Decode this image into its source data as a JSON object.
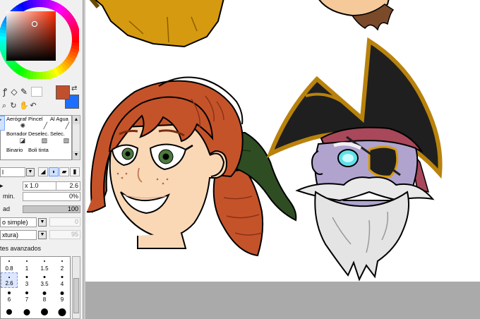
{
  "tools": [
    {
      "name": "aerografo",
      "label": "Aerógraf",
      "icon": "airbrush-icon"
    },
    {
      "name": "pincel",
      "label": "Pincel",
      "icon": "brush-icon"
    },
    {
      "name": "al-agua",
      "label": "Al Agua",
      "icon": "water-icon"
    },
    {
      "name": "borrador",
      "label": "Borrador",
      "icon": "eraser-icon"
    },
    {
      "name": "deselec",
      "label": "Deselec.",
      "icon": "deselect-icon"
    },
    {
      "name": "selec",
      "label": "Selec.",
      "icon": "select-icon"
    },
    {
      "name": "binario",
      "label": "Binario",
      "icon": ""
    },
    {
      "name": "boli-tinta",
      "label": "Boli tinta",
      "icon": ""
    }
  ],
  "settings": {
    "size_multiplier": "x 1.0",
    "size_value": "2.6",
    "min_label": "min.",
    "min_value": "0%",
    "density_label": "ad",
    "density_value": "100",
    "blend_label": "o simple)",
    "blend_value": "0",
    "texture_label": "xtura)",
    "texture_value": "95",
    "advanced_label": "tes avanzados"
  },
  "sizes": [
    {
      "label": "0.8",
      "dot": 2
    },
    {
      "label": "1",
      "dot": 2
    },
    {
      "label": "1.5",
      "dot": 2
    },
    {
      "label": "2",
      "dot": 2
    },
    {
      "label": "2.6",
      "dot": 2,
      "active": true
    },
    {
      "label": "3",
      "dot": 3
    },
    {
      "label": "3.5",
      "dot": 3
    },
    {
      "label": "4",
      "dot": 3
    },
    {
      "label": "6",
      "dot": 4
    },
    {
      "label": "7",
      "dot": 4
    },
    {
      "label": "8",
      "dot": 5
    },
    {
      "label": "9",
      "dot": 5
    },
    {
      "label": "",
      "dot": 8
    },
    {
      "label": "",
      "dot": 9
    },
    {
      "label": "",
      "dot": 10
    },
    {
      "label": "",
      "dot": 11
    }
  ],
  "colors": {
    "foreground": "#c0502d",
    "background": "#1e6fff",
    "canvas_bg": "#aaaaaa"
  }
}
